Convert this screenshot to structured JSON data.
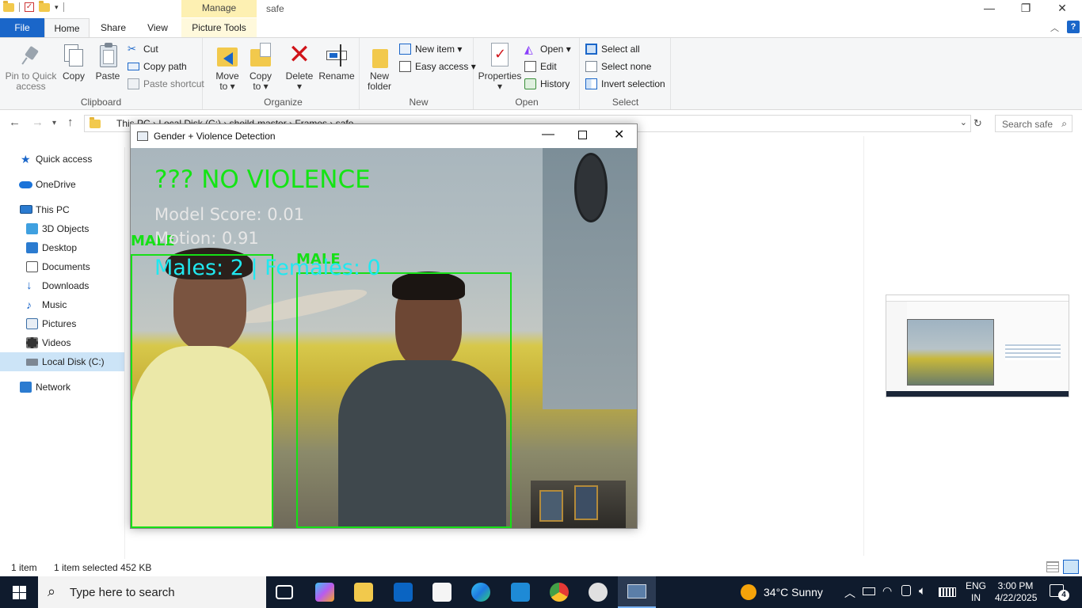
{
  "window": {
    "title": "safe",
    "context_tab": "Manage",
    "controls": {
      "minimize": "—",
      "restore": "❐",
      "close": "✕"
    }
  },
  "ribbon_tabs": {
    "file": "File",
    "home": "Home",
    "share": "Share",
    "view": "View",
    "picture_tools": "Picture Tools"
  },
  "ribbon": {
    "clipboard": {
      "label": "Clipboard",
      "pin": [
        "Pin to Quick",
        "access"
      ],
      "copy": "Copy",
      "paste": "Paste",
      "cut": "Cut",
      "copy_path": "Copy path",
      "paste_shortcut": "Paste shortcut"
    },
    "organize": {
      "label": "Organize",
      "move_to": [
        "Move",
        "to ▾"
      ],
      "copy_to": [
        "Copy",
        "to ▾"
      ],
      "delete": [
        "Delete",
        "▾"
      ],
      "rename": "Rename"
    },
    "new": {
      "label": "New",
      "new_folder": [
        "New",
        "folder"
      ],
      "new_item": "New item ▾",
      "easy_access": "Easy access ▾"
    },
    "open": {
      "label": "Open",
      "properties": [
        "Properties",
        "▾"
      ],
      "open": "Open ▾",
      "edit": "Edit",
      "history": "History"
    },
    "select": {
      "label": "Select",
      "select_all": "Select all",
      "select_none": "Select none",
      "invert_selection": "Invert selection"
    }
  },
  "address_bar": {
    "path": "This PC  ›  Local Disk (C:)  ›  sheild-master  ›  Frames  ›  safe",
    "search_placeholder": "Search safe"
  },
  "nav_pane": {
    "items": [
      {
        "label": "Quick access",
        "icon": "star-icon"
      },
      {
        "label": "OneDrive",
        "icon": "cloud-icon"
      },
      {
        "label": "This PC",
        "icon": "computer-icon"
      },
      {
        "label": "3D Objects",
        "icon": "cube-icon"
      },
      {
        "label": "Desktop",
        "icon": "desktop-icon"
      },
      {
        "label": "Documents",
        "icon": "document-icon"
      },
      {
        "label": "Downloads",
        "icon": "download-icon"
      },
      {
        "label": "Music",
        "icon": "music-icon"
      },
      {
        "label": "Pictures",
        "icon": "pictures-icon"
      },
      {
        "label": "Videos",
        "icon": "videos-icon"
      },
      {
        "label": "Local Disk (C:)",
        "icon": "disk-icon"
      },
      {
        "label": "Network",
        "icon": "network-icon"
      }
    ]
  },
  "status_bar": {
    "count": "1 item",
    "selection": "1 item selected  452 KB"
  },
  "detection_window": {
    "title": "Gender + Violence Detection",
    "status_text": "??? NO VIOLENCE",
    "model_score": "Model Score: 0.01",
    "motion": "Motion: 0.91",
    "counts": "Males: 2 | Females: 0",
    "box_label_1": "MALE",
    "box_label_2": "MALE",
    "colors": {
      "status": "#14e414",
      "info": "#e6e6e6",
      "counts": "#20e8f0",
      "box": "#16e016"
    }
  },
  "taskbar": {
    "search_placeholder": "Type here to search",
    "weather": "34°C  Sunny",
    "lang": [
      "ENG",
      "IN"
    ],
    "time": "3:00 PM",
    "date": "4/22/2025",
    "notifications": "4"
  }
}
